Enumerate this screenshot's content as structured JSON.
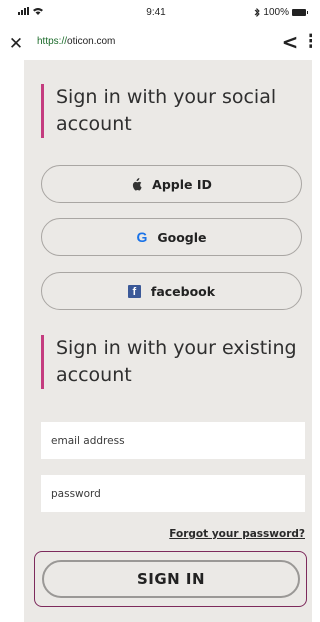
{
  "status_bar": {
    "time": "9:41",
    "battery": "100%",
    "icons": [
      "signal-bars-icon",
      "wifi-icon",
      "bluetooth-icon",
      "battery-icon"
    ]
  },
  "browser": {
    "url_scheme": "https://",
    "url_host": "oticon.com",
    "close_glyph": "✕",
    "share_glyph": "<",
    "menu_glyph": "⋮"
  },
  "social_section": {
    "heading": "Sign in with your social account",
    "buttons": [
      {
        "label": "Apple ID",
        "icon": "apple-icon",
        "glyph": ""
      },
      {
        "label": "Google",
        "icon": "google-icon",
        "glyph": "G"
      },
      {
        "label": "facebook",
        "icon": "facebook-icon",
        "glyph": "f"
      }
    ]
  },
  "existing_section": {
    "heading": "Sign in with your existing account",
    "email_placeholder": "email address",
    "password_placeholder": "password",
    "forgot_link": "Forgot your password?",
    "signin_label": "SIGN IN"
  },
  "colors": {
    "accent": "#c43c7f",
    "panel_bg": "#ebe9e6",
    "facebook": "#3b5998",
    "google": "#1a73e8"
  }
}
